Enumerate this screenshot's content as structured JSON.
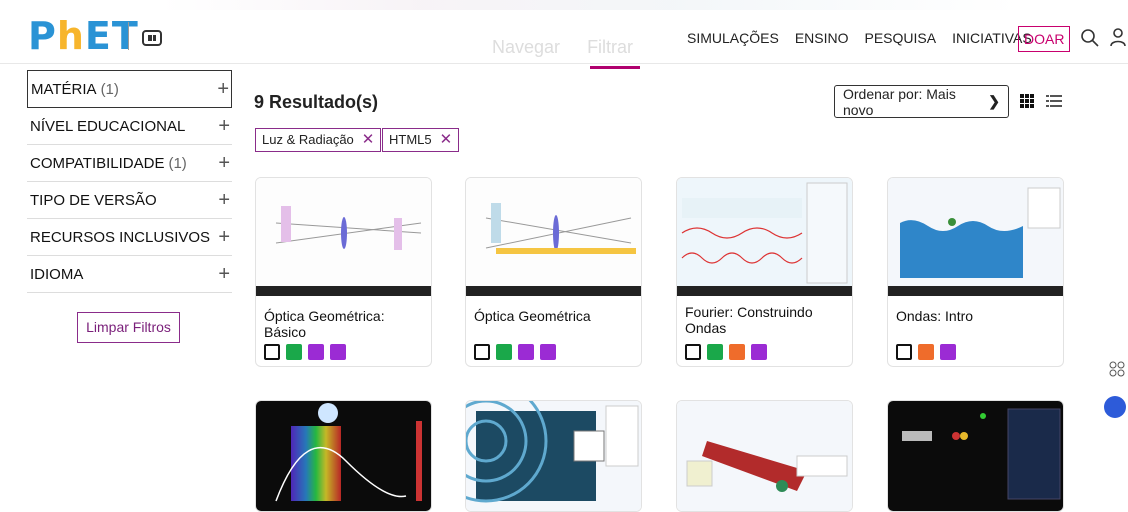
{
  "header": {
    "logo_text": "PhET",
    "view_tabs": [
      "Navegar",
      "Filtrar"
    ],
    "nav_items": [
      "SIMULAÇÕES",
      "ENSINO",
      "PESQUISA",
      "INICIATIVAS"
    ],
    "donate_label": "DOAR",
    "icons": [
      "search-icon",
      "user-icon"
    ]
  },
  "sidebar": {
    "filters": [
      {
        "label": "MATÉRIA",
        "count": "(1)"
      },
      {
        "label": "NÍVEL EDUCACIONAL",
        "count": ""
      },
      {
        "label": "COMPATIBILIDADE",
        "count": "(1)"
      },
      {
        "label": "TIPO DE VERSÃO",
        "count": ""
      },
      {
        "label": "RECURSOS INCLUSIVOS",
        "count": ""
      },
      {
        "label": "IDIOMA",
        "count": ""
      }
    ],
    "clear_label": "Limpar Filtros"
  },
  "results": {
    "title": "9 Resultado(s)",
    "chips": [
      "Luz & Radiação",
      "HTML5"
    ],
    "sort_label": "Ordenar por: Mais novo"
  },
  "cards": [
    {
      "title": "Óptica Geométrica: Básico",
      "badges": [
        "html5",
        "keyboard",
        "zoom",
        "touch"
      ]
    },
    {
      "title": "Óptica Geométrica",
      "badges": [
        "html5",
        "keyboard",
        "zoom",
        "touch"
      ]
    },
    {
      "title": "Fourier: Construindo Ondas",
      "badges": [
        "html5",
        "keyboard",
        "sound",
        "zoom"
      ]
    },
    {
      "title": "Ondas: Intro",
      "badges": [
        "html5",
        "sound",
        "zoom"
      ]
    }
  ],
  "colors": {
    "brand_magenta": "#b0006e",
    "accent_purple": "#8a2c8a",
    "logo_blue": "#2a93d5",
    "logo_yellow": "#f7b52c"
  }
}
